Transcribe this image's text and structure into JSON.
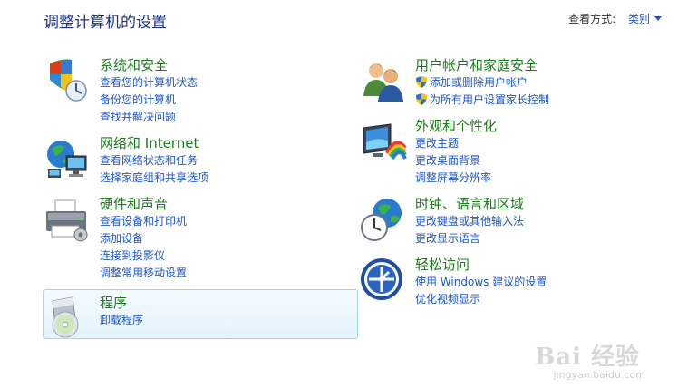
{
  "header": {
    "title": "调整计算机的设置",
    "view_by_label": "查看方式:",
    "view_by_value": "类别"
  },
  "categories": [
    {
      "name": "system",
      "title": "系统和安全",
      "icon": "shield-icon",
      "links": [
        "查看您的计算机状态",
        "备份您的计算机",
        "查找并解决问题"
      ]
    },
    {
      "name": "network",
      "title": "网络和 Internet",
      "icon": "network-globe-icon",
      "links": [
        "查看网络状态和任务",
        "选择家庭组和共享选项"
      ]
    },
    {
      "name": "hardware",
      "title": "硬件和声音",
      "icon": "printer-icon",
      "links": [
        "查看设备和打印机",
        "添加设备",
        "连接到投影仪",
        "调整常用移动设置"
      ]
    },
    {
      "name": "programs",
      "title": "程序",
      "icon": "program-disc-icon",
      "links": [
        "卸载程序"
      ]
    },
    {
      "name": "users",
      "title": "用户帐户和家庭安全",
      "icon": "users-icon",
      "links": [
        "添加或删除用户帐户",
        "为所有用户设置家长控制"
      ]
    },
    {
      "name": "appearance",
      "title": "外观和个性化",
      "icon": "monitor-palette-icon",
      "links": [
        "更改主题",
        "更改桌面背景",
        "调整屏幕分辨率"
      ]
    },
    {
      "name": "clock",
      "title": "时钟、语言和区域",
      "icon": "clock-globe-icon",
      "links": [
        "更改键盘或其他输入法",
        "更改显示语言"
      ]
    },
    {
      "name": "ease",
      "title": "轻松访问",
      "icon": "ease-of-access-icon",
      "links": [
        "使用 Windows 建议的设置",
        "优化视频显示"
      ]
    }
  ],
  "watermark": {
    "text": "Bai 经验",
    "subtext": "jingyan.baidu.com"
  }
}
